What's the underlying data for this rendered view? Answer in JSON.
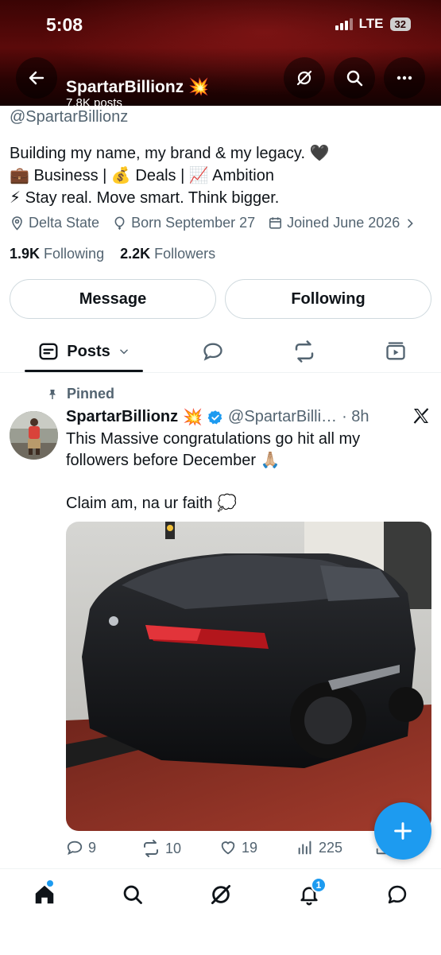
{
  "status_bar": {
    "time": "5:08",
    "network": "LTE",
    "battery": "32"
  },
  "header": {
    "name": "SpartarBillionz 💥",
    "posts": "7.8K posts"
  },
  "profile": {
    "handle": "@SpartarBillionz",
    "bio": [
      "Building my name, my brand & my legacy. 🖤",
      "💼 Business | 💰 Deals | 📈 Ambition",
      "⚡ Stay real. Move smart. Think bigger."
    ],
    "location": "Delta State",
    "birthday": "Born September 27",
    "joined": "Joined June 2026",
    "following_count": "1.9K",
    "following_label": "Following",
    "followers_count": "2.2K",
    "followers_label": "Followers"
  },
  "buttons": {
    "message": "Message",
    "following": "Following"
  },
  "tabs": {
    "posts": "Posts"
  },
  "tweet": {
    "pinned_label": "Pinned",
    "author_name": "SpartarBillionz",
    "author_emoji": "💥",
    "author_handle": "@SpartarBilli…",
    "time": "· 8h",
    "text_line1": "This Massive congratulations go hit all my followers before December 🙏🏼",
    "text_line2": "Claim am, na ur faith 💭",
    "replies": "9",
    "reposts": "10",
    "likes": "19",
    "views": "225"
  },
  "nav": {
    "notifications_badge": "1"
  },
  "colors": {
    "accent": "#1d9bf0",
    "header_bg": "#3a0404",
    "text": "#0f1419",
    "muted": "#536471"
  }
}
